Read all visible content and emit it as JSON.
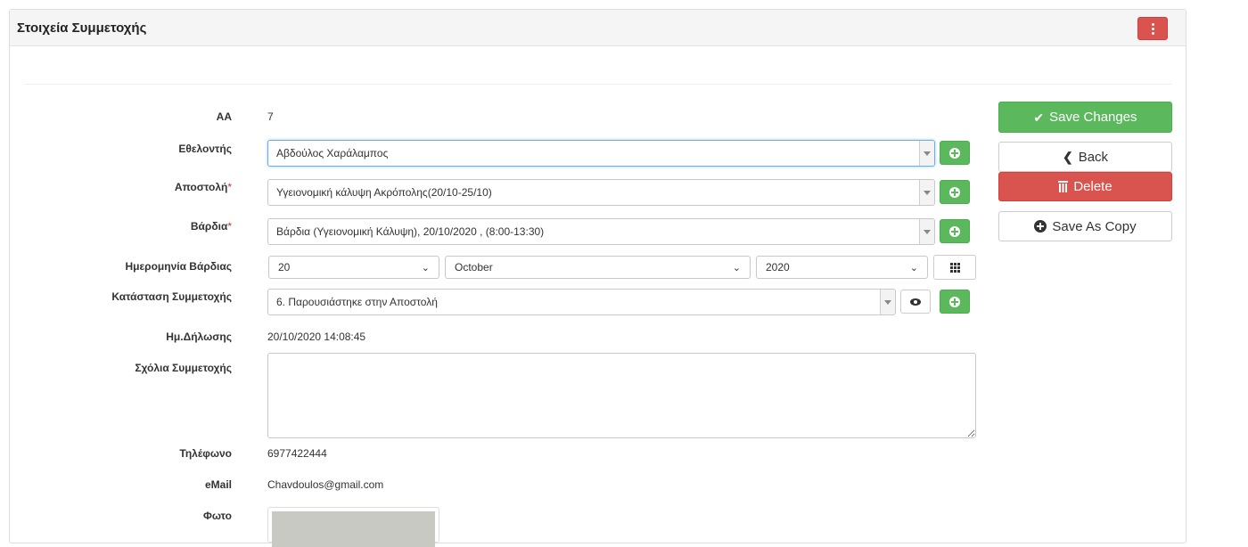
{
  "panel": {
    "title": "Στοιχεία Συμμετοχής"
  },
  "form": {
    "aa": {
      "label": "AA",
      "value": "7"
    },
    "volunteer": {
      "label": "Εθελοντής",
      "value": "Αβδούλος Χαράλαμπος"
    },
    "mission": {
      "label": "Αποστολή",
      "required_mark": "*",
      "value": "Υγειονομική κάλυψη Ακρόπολης(20/10-25/10)"
    },
    "shift": {
      "label": "Βάρδια",
      "required_mark": "*",
      "value": "Βάρδια (Υγειονομική Κάλυψη), 20/10/2020 , (8:00-13:30)"
    },
    "shift_date": {
      "label": "Ημερομηνία Βάρδιας",
      "day": "20",
      "month": "October",
      "year": "2020"
    },
    "status": {
      "label": "Κατάσταση Συμμετοχής",
      "value": "6. Παρουσιάστηκε στην Αποστολή"
    },
    "declaration_date": {
      "label": "Ημ.Δήλωσης",
      "value": "20/10/2020 14:08:45"
    },
    "comments": {
      "label": "Σχόλια Συμμετοχής",
      "value": ""
    },
    "phone": {
      "label": "Τηλέφωνο",
      "value": "6977422444"
    },
    "email": {
      "label": "eMail",
      "value": "Chavdoulos@gmail.com"
    },
    "photo": {
      "label": "Φωτο"
    }
  },
  "actions": {
    "save_changes": "Save Changes",
    "back": "Back",
    "delete": "Delete",
    "save_as_copy": "Save As Copy"
  },
  "icons": {
    "kebab": "kebab-menu-icon",
    "add": "plus-circle-icon",
    "calendar": "grid-calendar-icon",
    "view": "eye-icon",
    "check": "check-icon",
    "back": "chevron-left-icon",
    "trash": "trash-icon",
    "copy": "plus-circle-icon"
  },
  "colors": {
    "success": "#5cb85c",
    "danger": "#d9534f",
    "header_bg": "#f5f5f5"
  }
}
